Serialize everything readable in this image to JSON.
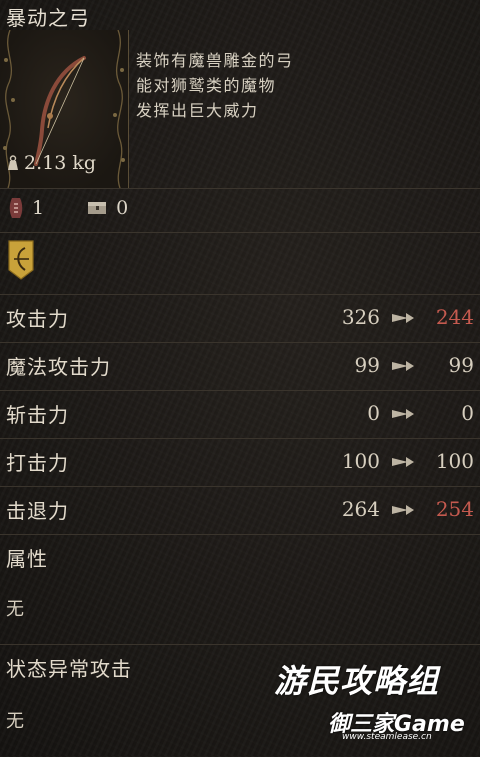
{
  "item": {
    "name": "暴动之弓",
    "description": [
      "装饰有魔兽雕金的弓",
      "能对狮鹫类的魔物",
      "发挥出巨大威力"
    ],
    "weight": "2.13 kg",
    "icon": "bow-icon"
  },
  "counts": {
    "slot_count": "1",
    "chest_count": "0"
  },
  "stats": [
    {
      "label": "攻击力",
      "current": "326",
      "new": "244",
      "decreased": true
    },
    {
      "label": "魔法攻击力",
      "current": "99",
      "new": "99",
      "decreased": false
    },
    {
      "label": "斩击力",
      "current": "0",
      "new": "0",
      "decreased": false
    },
    {
      "label": "打击力",
      "current": "100",
      "new": "100",
      "decreased": false
    },
    {
      "label": "击退力",
      "current": "264",
      "new": "254",
      "decreased": true
    }
  ],
  "attribute": {
    "label": "属性",
    "value": "无"
  },
  "status_attack": {
    "label": "状态异常攻击",
    "value": "无"
  },
  "watermarks": {
    "primary": "游民攻略组",
    "secondary": "御三家Game",
    "url": "www.steamlease.cn"
  },
  "colors": {
    "decrease": "#c55a4f",
    "frame": "#5a4d36",
    "text": "#ddd6c8"
  }
}
